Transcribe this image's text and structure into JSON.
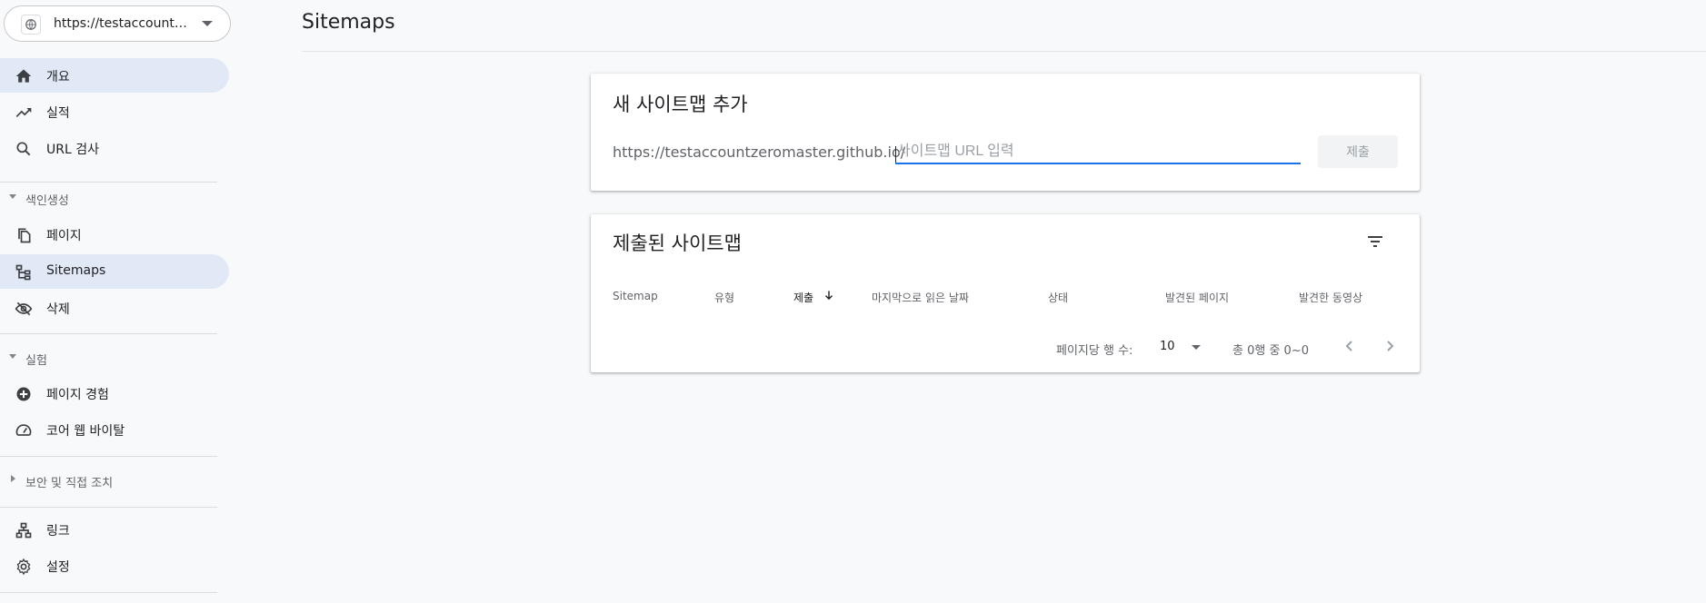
{
  "property": {
    "url": "https://testaccountzeromaster.github.io/",
    "icon": "globe-icon"
  },
  "sidebar": {
    "items_top": [
      {
        "label": "개요",
        "icon": "home-icon",
        "active": true
      },
      {
        "label": "실적",
        "icon": "trending-up-icon",
        "active": false
      },
      {
        "label": "URL 검사",
        "icon": "search-icon",
        "active": false
      }
    ],
    "section_index": {
      "label": "색인생성"
    },
    "items_index": [
      {
        "label": "페이지",
        "icon": "pages-icon",
        "active": false
      },
      {
        "label": "Sitemaps",
        "icon": "sitemap-icon",
        "active": true
      },
      {
        "label": "삭제",
        "icon": "visibility-off-icon",
        "active": false
      }
    ],
    "section_experience": {
      "label": "실험"
    },
    "items_experience": [
      {
        "label": "페이지 경험",
        "icon": "plus-circle-icon",
        "active": false
      },
      {
        "label": "코어 웹 바이탈",
        "icon": "speed-icon",
        "active": false
      }
    ],
    "section_security": {
      "label": "보안 및 직접 조치"
    },
    "items_bottom": [
      {
        "label": "링크",
        "icon": "links-icon",
        "active": false
      },
      {
        "label": "설정",
        "icon": "settings-icon",
        "active": false
      }
    ]
  },
  "header": {
    "title": "Sitemaps"
  },
  "add_card": {
    "title": "새 사이트맵 추가",
    "prefix": "https://testaccountzeromaster.github.io/",
    "input_value": "",
    "input_placeholder": "사이트맵 URL 입력",
    "submit_label": "제출"
  },
  "submitted_card": {
    "title": "제출된 사이트맵",
    "columns": [
      "Sitemap",
      "유형",
      "제출",
      "마지막으로 읽은 날짜",
      "상태",
      "발견된 페이지",
      "발견한 동영상"
    ],
    "sorted_column": "제출",
    "rows": [],
    "rows_per_page_label": "페이지당 행 수:",
    "rows_per_page": "10",
    "range_label": "총 0행 중 0~0"
  },
  "colors": {
    "accent": "#1a73e8",
    "active_nav": "#e1e9f7"
  }
}
